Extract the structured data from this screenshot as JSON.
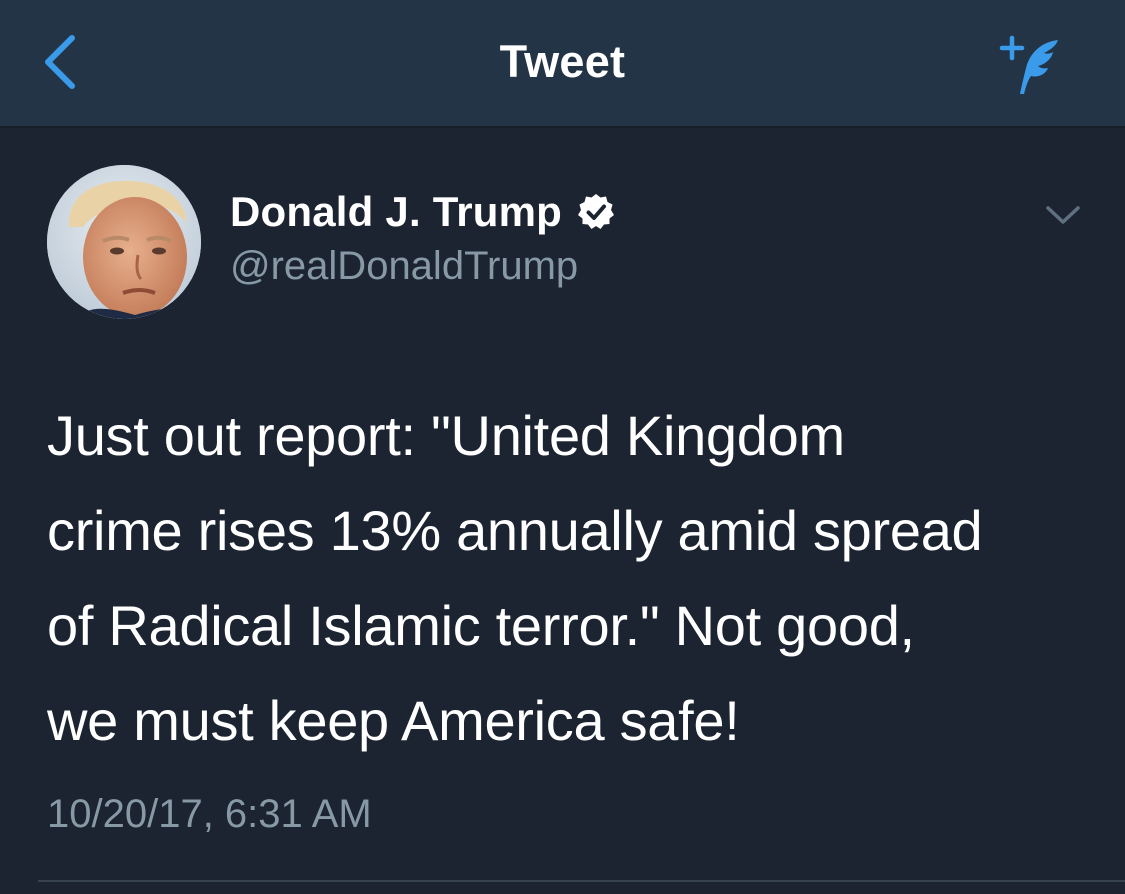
{
  "navbar": {
    "title": "Tweet",
    "back_icon": "chevron-left-icon",
    "compose_icon": "compose-tweet-icon"
  },
  "tweet": {
    "author": {
      "name": "Donald J. Trump",
      "handle": "@realDonaldTrump",
      "verified": true,
      "avatar": "profile-photo"
    },
    "text_lines": [
      "Just out report: \"United Kingdom",
      "crime rises 13% annually amid spread",
      "of Radical Islamic terror.\" Not good,",
      "we must keep America safe!"
    ],
    "timestamp": "10/20/17, 6:31 AM"
  },
  "colors": {
    "background": "#1c2431",
    "navbar": "#243447",
    "accent": "#1da1f2",
    "secondary_text": "#8899a6",
    "primary_text": "#ffffff"
  }
}
